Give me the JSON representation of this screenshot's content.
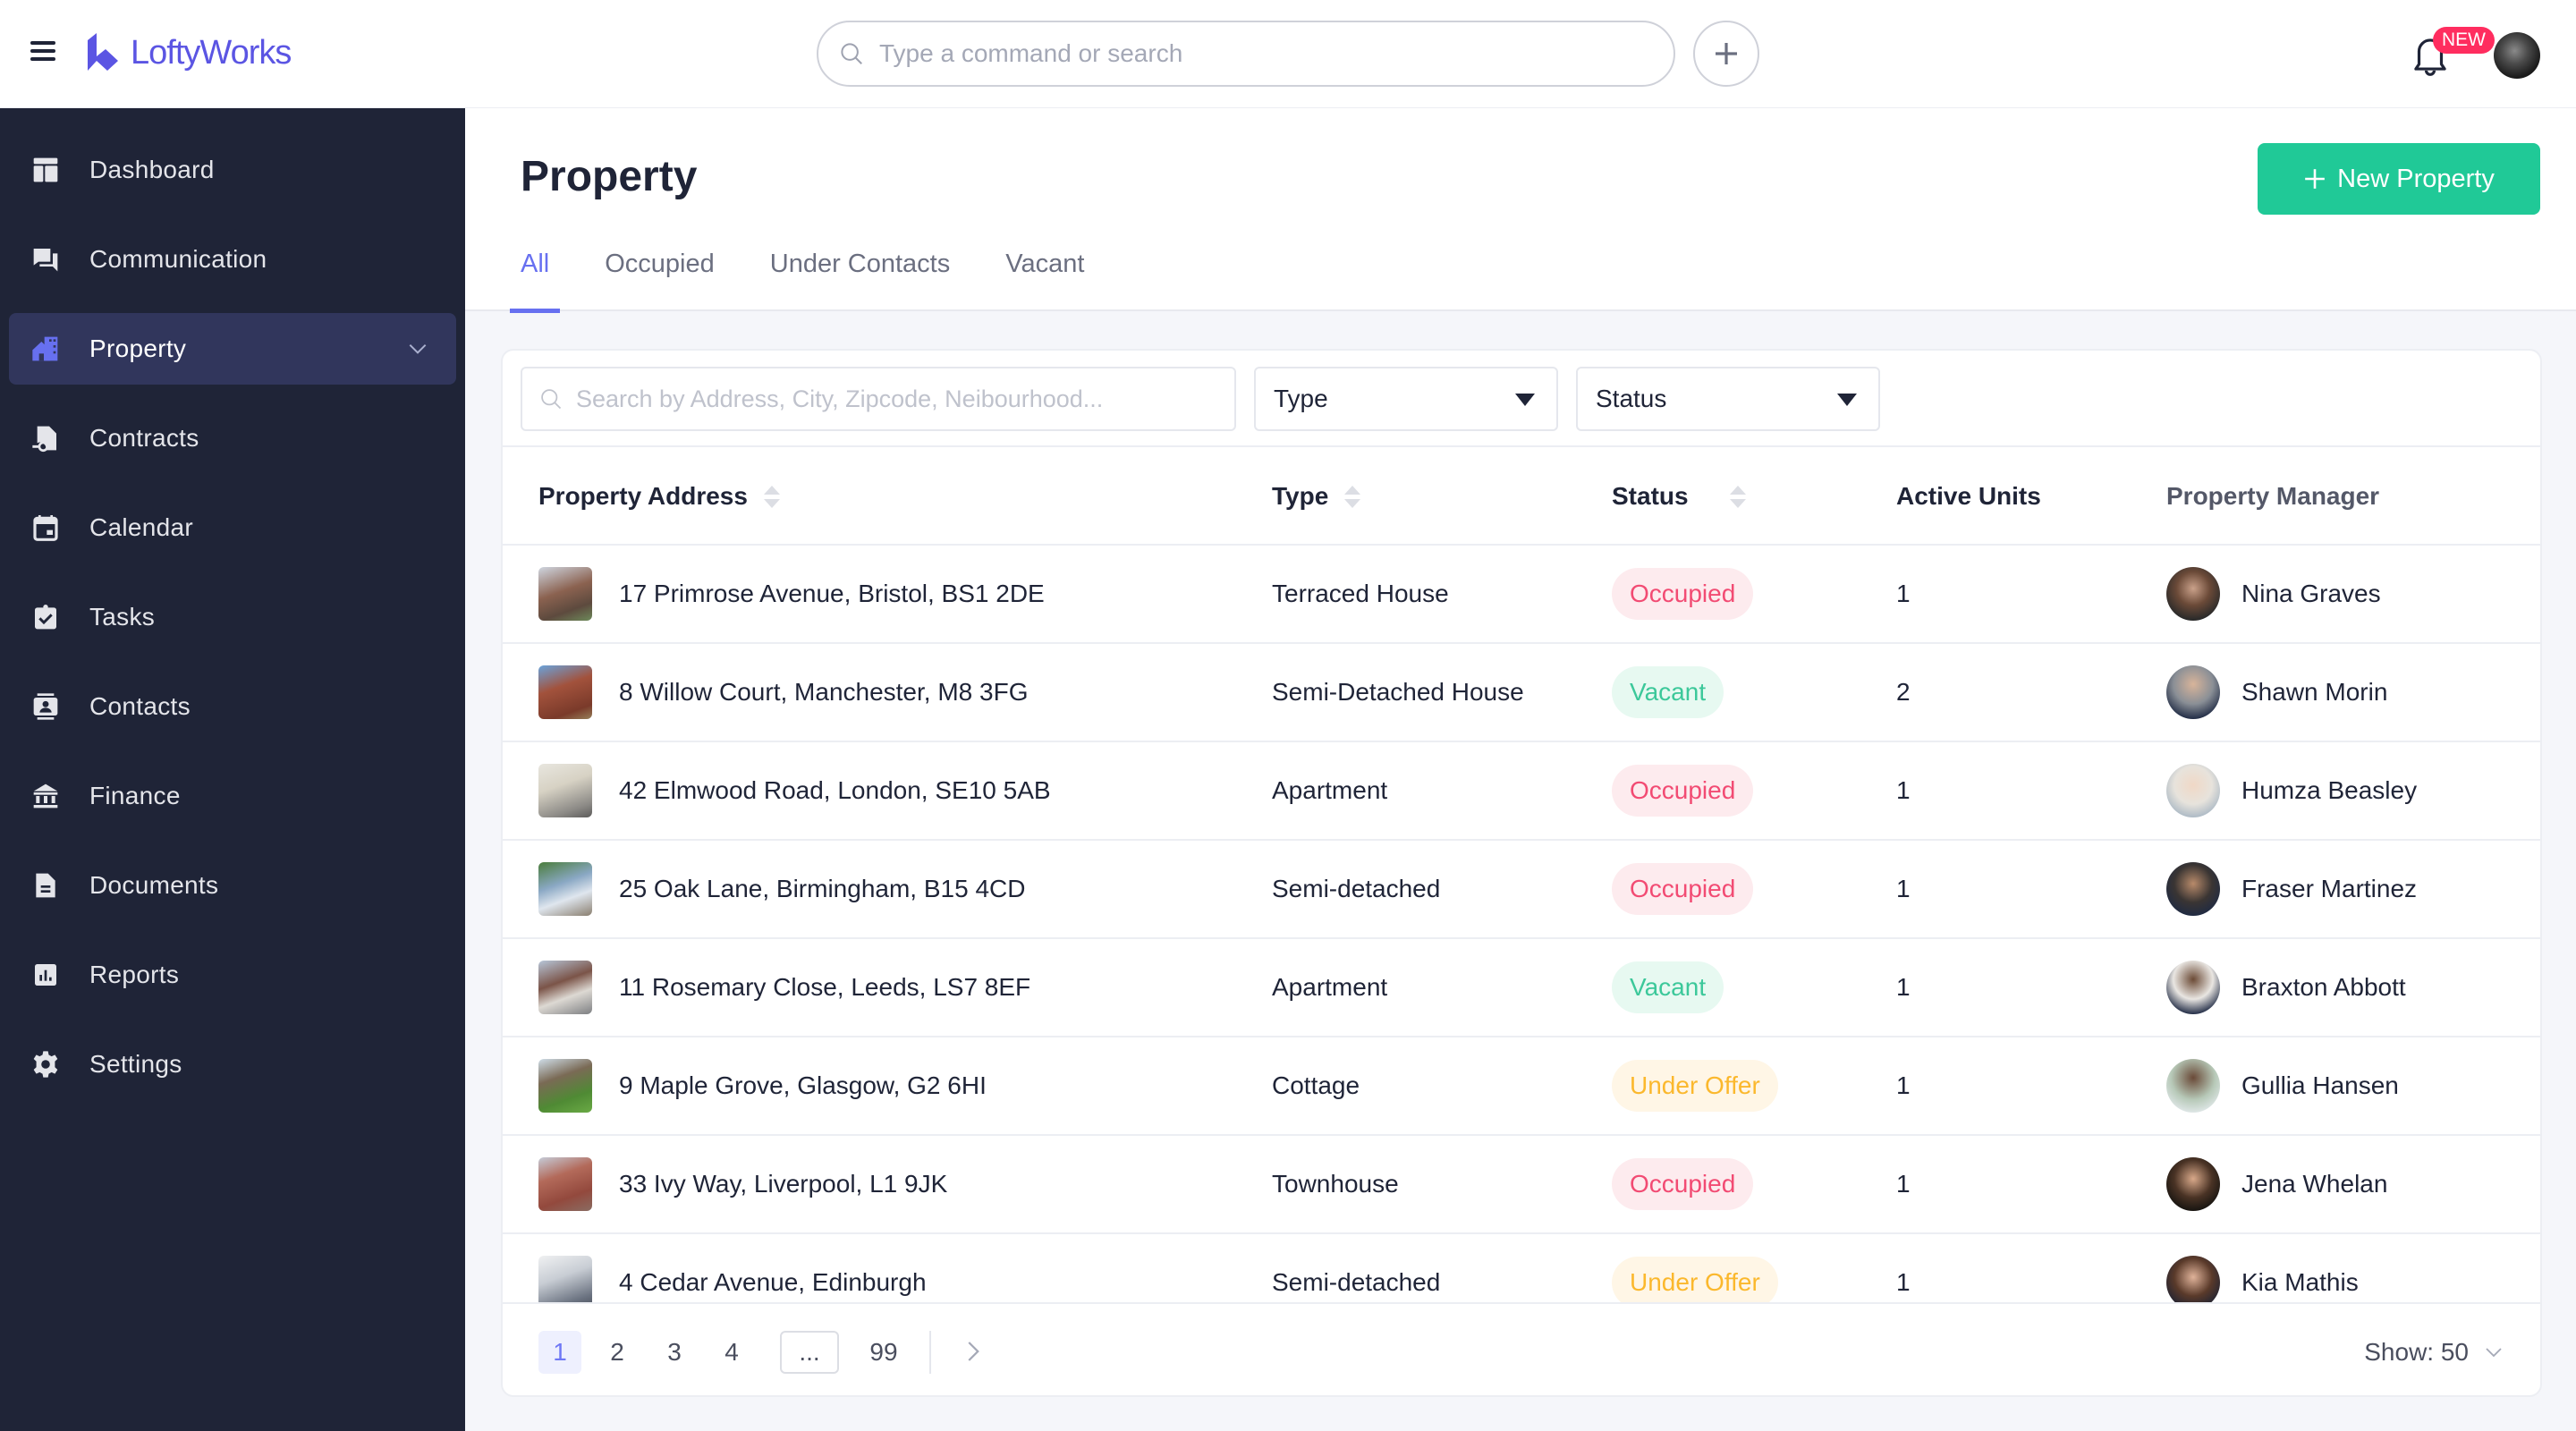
{
  "app": {
    "brand": "LoftyWorks",
    "brand_color": "#5b55e3",
    "accent_color": "#6770f0",
    "primary_button_color": "#20c997",
    "sidebar_bg": "#1f2437"
  },
  "topbar": {
    "search_placeholder": "Type a command or search",
    "notification_badge": "NEW",
    "icons": [
      "hamburger-menu-icon",
      "search-icon",
      "plus-icon",
      "bell-icon",
      "user-avatar"
    ]
  },
  "sidebar": {
    "items": [
      {
        "label": "Dashboard",
        "icon": "dashboard-icon",
        "active": false
      },
      {
        "label": "Communication",
        "icon": "chat-icon",
        "active": false
      },
      {
        "label": "Property",
        "icon": "property-icon",
        "active": true,
        "expandable": true
      },
      {
        "label": "Contracts",
        "icon": "contract-icon",
        "active": false
      },
      {
        "label": "Calendar",
        "icon": "calendar-icon",
        "active": false
      },
      {
        "label": "Tasks",
        "icon": "tasks-icon",
        "active": false
      },
      {
        "label": "Contacts",
        "icon": "contacts-icon",
        "active": false
      },
      {
        "label": "Finance",
        "icon": "bank-icon",
        "active": false
      },
      {
        "label": "Documents",
        "icon": "document-icon",
        "active": false
      },
      {
        "label": "Reports",
        "icon": "reports-icon",
        "active": false
      },
      {
        "label": "Settings",
        "icon": "gear-icon",
        "active": false
      }
    ]
  },
  "page": {
    "title": "Property",
    "new_button_label": "New Property",
    "tabs": [
      {
        "label": "All",
        "active": true
      },
      {
        "label": "Occupied",
        "active": false
      },
      {
        "label": "Under Contacts",
        "active": false
      },
      {
        "label": "Vacant",
        "active": false
      }
    ]
  },
  "filters": {
    "search_placeholder": "Search by Address, City, Zipcode, Neibourhood...",
    "type_label": "Type",
    "status_label": "Status"
  },
  "table": {
    "columns": [
      "Property Address",
      "Type",
      "Status",
      "Active Units",
      "Property Manager"
    ],
    "rows": [
      {
        "address": "17 Primrose Avenue, Bristol, BS1 2DE",
        "type": "Terraced House",
        "status": "Occupied",
        "status_key": "occupied",
        "units": "1",
        "manager": "Nina Graves"
      },
      {
        "address": "8 Willow Court, Manchester, M8 3FG",
        "type": "Semi-Detached House",
        "status": "Vacant",
        "status_key": "vacant",
        "units": "2",
        "manager": "Shawn Morin"
      },
      {
        "address": "42 Elmwood Road, London, SE10 5AB",
        "type": "Apartment",
        "status": "Occupied",
        "status_key": "occupied",
        "units": "1",
        "manager": "Humza Beasley"
      },
      {
        "address": "25 Oak Lane, Birmingham, B15 4CD",
        "type": "Semi-detached",
        "status": "Occupied",
        "status_key": "occupied",
        "units": "1",
        "manager": "Fraser Martinez"
      },
      {
        "address": "11 Rosemary Close, Leeds, LS7 8EF",
        "type": "Apartment",
        "status": "Vacant",
        "status_key": "vacant",
        "units": "1",
        "manager": "Braxton Abbott"
      },
      {
        "address": "9 Maple Grove, Glasgow, G2 6HI",
        "type": "Cottage",
        "status": "Under Offer",
        "status_key": "underoffer",
        "units": "1",
        "manager": "Gullia Hansen"
      },
      {
        "address": "33 Ivy Way, Liverpool, L1 9JK",
        "type": "Townhouse",
        "status": "Occupied",
        "status_key": "occupied",
        "units": "1",
        "manager": "Jena Whelan"
      },
      {
        "address": "4 Cedar Avenue, Edinburgh",
        "type": "Semi-detached",
        "status": "Under Offer",
        "status_key": "underoffer",
        "units": "1",
        "manager": "Kia Mathis"
      }
    ],
    "status_colors": {
      "occupied": {
        "text": "#f24b73",
        "bg": "#fdebee"
      },
      "vacant": {
        "text": "#3cc89a",
        "bg": "#e7f9f1"
      },
      "underoffer": {
        "text": "#fbb82d",
        "bg": "#fff6e6"
      }
    }
  },
  "pagination": {
    "pages": [
      "1",
      "2",
      "3",
      "4",
      "...",
      "99"
    ],
    "current": "1",
    "show_label": "Show: 50"
  }
}
